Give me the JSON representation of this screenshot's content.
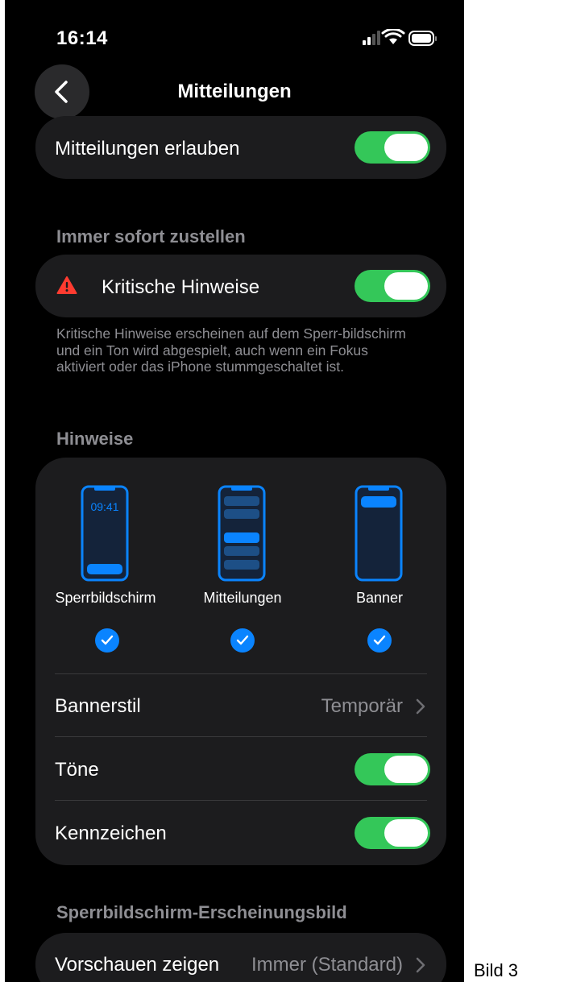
{
  "status_bar": {
    "time": "16:14"
  },
  "nav": {
    "title": "Mitteilungen"
  },
  "allow": {
    "label": "Mitteilungen erlauben",
    "on": true
  },
  "immediate": {
    "header": "Immer sofort zustellen",
    "critical_label": "Kritische Hinweise",
    "critical_on": true,
    "footer": "Kritische Hinweise erscheinen auf dem Sperr-bildschirm und ein Ton wird abgespielt, auch wenn ein Fokus aktiviert oder das iPhone stummgeschaltet ist."
  },
  "alerts": {
    "header": "Hinweise",
    "options": [
      {
        "label": "Sperrbildschirm",
        "selected": true,
        "clock": "09:41"
      },
      {
        "label": "Mitteilungen",
        "selected": true
      },
      {
        "label": "Banner",
        "selected": true
      }
    ],
    "banner_style": {
      "label": "Bannerstil",
      "value": "Temporär"
    },
    "sounds": {
      "label": "Töne",
      "on": true
    },
    "badges": {
      "label": "Kennzeichen",
      "on": true
    }
  },
  "lockscreen": {
    "header": "Sperrbildschirm-Erscheinungsbild",
    "show_previews": {
      "label": "Vorschauen zeigen",
      "value": "Immer (Standard)"
    }
  },
  "caption": "Bild 3",
  "colors": {
    "accent_green": "#34c759",
    "accent_blue": "#0a84ff",
    "warning_red": "#ff3b30"
  }
}
